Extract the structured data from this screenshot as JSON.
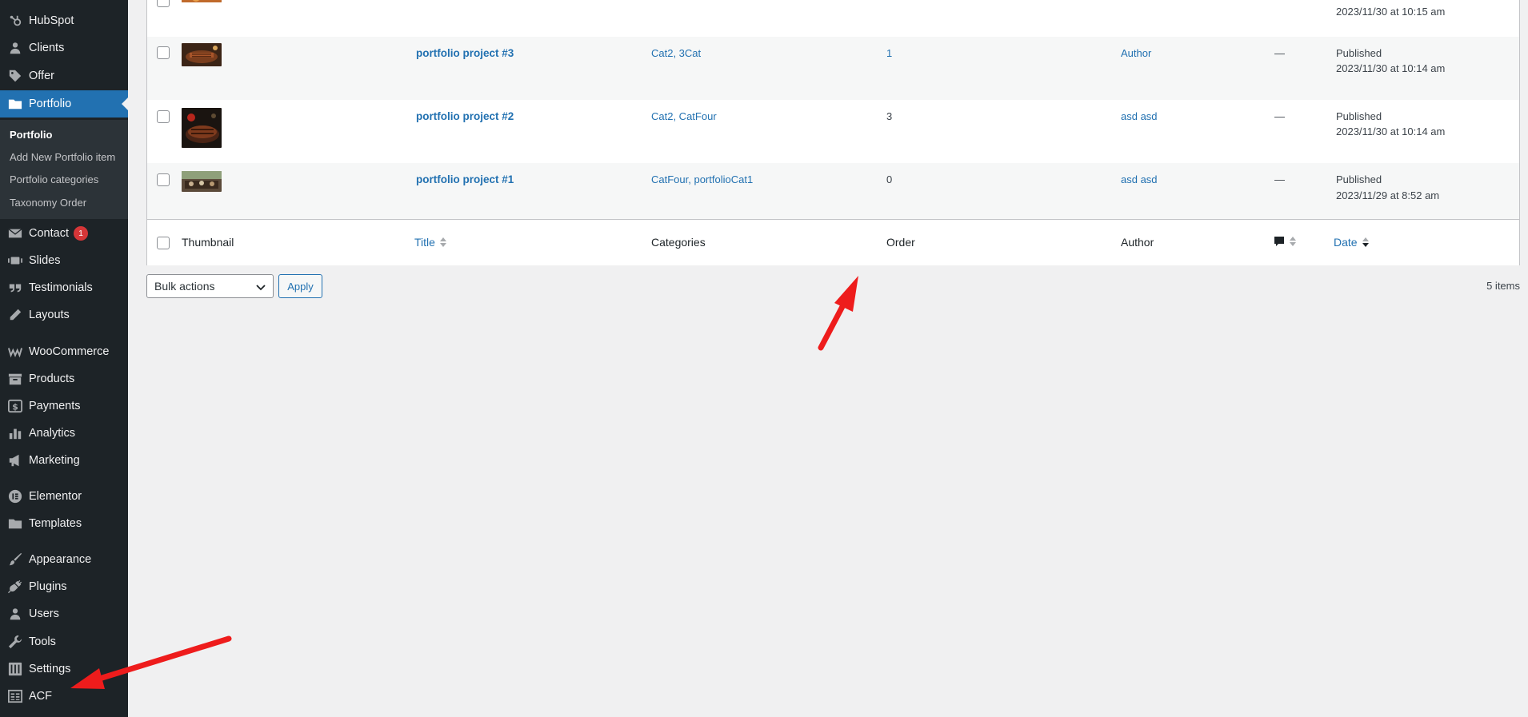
{
  "sidebar": {
    "items": [
      {
        "label": "HubSpot",
        "icon": "hubspot-icon"
      },
      {
        "label": "Clients",
        "icon": "user-icon"
      },
      {
        "label": "Offer",
        "icon": "tag-icon"
      },
      {
        "label": "Portfolio",
        "icon": "folder-icon"
      },
      {
        "label": "Contact",
        "icon": "mail-icon",
        "badge": "1"
      },
      {
        "label": "Slides",
        "icon": "slides-icon"
      },
      {
        "label": "Testimonials",
        "icon": "quote-icon"
      },
      {
        "label": "Layouts",
        "icon": "pencil-icon"
      },
      {
        "label": "WooCommerce",
        "icon": "woo-icon"
      },
      {
        "label": "Products",
        "icon": "archive-icon"
      },
      {
        "label": "Payments",
        "icon": "dollar-icon"
      },
      {
        "label": "Analytics",
        "icon": "bar-chart-icon"
      },
      {
        "label": "Marketing",
        "icon": "megaphone-icon"
      },
      {
        "label": "Elementor",
        "icon": "elementor-icon"
      },
      {
        "label": "Templates",
        "icon": "folder-icon"
      },
      {
        "label": "Appearance",
        "icon": "brush-icon"
      },
      {
        "label": "Plugins",
        "icon": "plug-icon"
      },
      {
        "label": "Users",
        "icon": "user-icon"
      },
      {
        "label": "Tools",
        "icon": "wrench-icon"
      },
      {
        "label": "Settings",
        "icon": "settings-icon"
      },
      {
        "label": "ACF",
        "icon": "grid-icon"
      }
    ],
    "submenu": [
      {
        "label": "Portfolio"
      },
      {
        "label": "Add New Portfolio item"
      },
      {
        "label": "Portfolio categories"
      },
      {
        "label": "Taxonomy Order"
      }
    ]
  },
  "table": {
    "partial_row": {
      "date_time": "2023/11/30 at 10:15 am"
    },
    "rows": [
      {
        "title": "portfolio project #3",
        "categories": "Cat2, 3Cat",
        "order": "1",
        "author": "Author",
        "comments": "—",
        "status": "Published",
        "date_time": "2023/11/30 at 10:14 am"
      },
      {
        "title": "portfolio project #2",
        "categories": "Cat2, CatFour",
        "order": "3",
        "author": "asd asd",
        "comments": "—",
        "status": "Published",
        "date_time": "2023/11/30 at 10:14 am"
      },
      {
        "title": "portfolio project #1",
        "categories": "CatFour, portfolioCat1",
        "order": "0",
        "author": "asd asd",
        "comments": "—",
        "status": "Published",
        "date_time": "2023/11/29 at 8:52 am"
      }
    ],
    "columns": {
      "thumbnail": "Thumbnail",
      "title": "Title",
      "categories": "Categories",
      "order": "Order",
      "author": "Author",
      "comments": "comment-icon",
      "date": "Date"
    }
  },
  "bulk": {
    "select_value": "Bulk actions",
    "apply_label": "Apply"
  },
  "items_count": "5 items",
  "colors": {
    "accent": "#2271b1",
    "sidebar_bg": "#1d2327",
    "annotation": "#ee1c1c"
  }
}
